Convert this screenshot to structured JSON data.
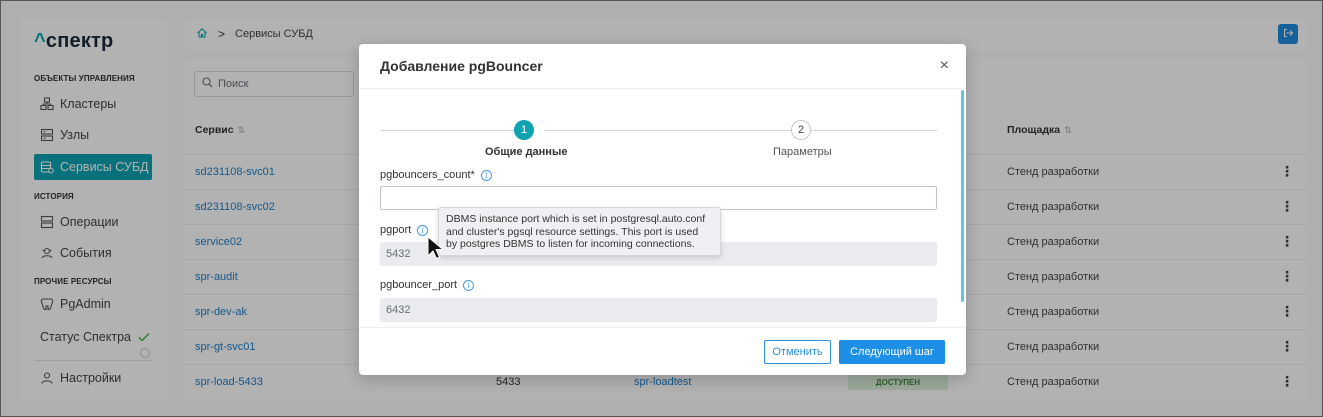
{
  "app": {
    "logo_caret": "^",
    "logo_text": "спектр"
  },
  "sidebar": {
    "sections": [
      {
        "title": "ОБЪЕКТЫ УПРАВЛЕНИЯ"
      },
      {
        "title": "ИСТОРИЯ"
      },
      {
        "title": "ПРОЧИЕ РЕСУРСЫ"
      }
    ],
    "items": [
      {
        "label": "Кластеры",
        "icon": "cluster-icon"
      },
      {
        "label": "Узлы",
        "icon": "server-icon"
      },
      {
        "label": "Сервисы СУБД",
        "icon": "db-service-icon",
        "active": true
      },
      {
        "label": "Операции",
        "icon": "operations-icon"
      },
      {
        "label": "События",
        "icon": "events-icon"
      },
      {
        "label": "PgAdmin",
        "icon": "elephant-icon"
      },
      {
        "label": "Статус Спектра",
        "icon": "check-icon"
      },
      {
        "label": "Настройки",
        "icon": "user-icon"
      }
    ]
  },
  "header": {
    "breadcrumb": [
      "Сервисы СУБД"
    ],
    "home_icon": "home-icon",
    "logout_icon": "logout-icon"
  },
  "main": {
    "search_placeholder": "Поиск",
    "columns": {
      "service": "Сервис",
      "site": "Площадка"
    },
    "rows": [
      {
        "service": "sd231108-svc01",
        "site": "Стенд разработки"
      },
      {
        "service": "sd231108-svc02",
        "site": "Стенд разработки"
      },
      {
        "service": "service02",
        "site": "Стенд разработки"
      },
      {
        "service": "spr-audit",
        "site": "Стенд разработки"
      },
      {
        "service": "spr-dev-ak",
        "site": "Стенд разработки"
      },
      {
        "service": "spr-gt-svc01",
        "site": "Стенд разработки"
      },
      {
        "service": "spr-load-5433",
        "site": "Стенд разработки",
        "port": "5433",
        "cluster": "spr-loadtest",
        "status": "ДОСТУПЕН"
      }
    ]
  },
  "modal": {
    "title": "Добавление pgBouncer",
    "close_icon": "close-icon",
    "steps": [
      {
        "number": "1",
        "label": "Общие данные",
        "active": true
      },
      {
        "number": "2",
        "label": "Параметры",
        "active": false
      }
    ],
    "fields": [
      {
        "label": "pgbouncers_count*",
        "value": "",
        "readonly": false
      },
      {
        "label": "pgport",
        "value": "5432",
        "readonly": true
      },
      {
        "label": "pgbouncer_port",
        "value": "6432",
        "readonly": true
      }
    ],
    "tooltip": [
      "DBMS instance port which is set in postgresql.auto.conf",
      "and cluster's pgsql resource settings. This port is used",
      "by postgres DBMS to listen for incoming connections."
    ],
    "cancel_label": "Отменить",
    "next_label": "Следующий шаг"
  },
  "colors": {
    "accent_teal": "#0ea3b1",
    "primary_blue": "#1e8fe6",
    "link_blue": "#1d7fc7",
    "status_green_bg": "#dff4de"
  }
}
